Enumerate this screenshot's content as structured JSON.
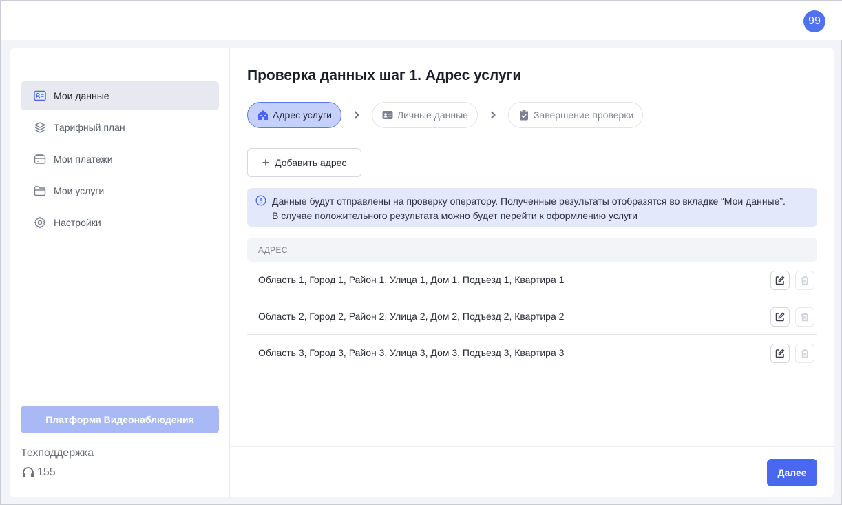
{
  "header": {
    "avatar_text": "99"
  },
  "sidebar": {
    "items": [
      {
        "label": "Мои данные",
        "icon": "id-card-icon",
        "active": true
      },
      {
        "label": "Тарифный план",
        "icon": "layers-icon",
        "active": false
      },
      {
        "label": "Мои платежи",
        "icon": "wallet-icon",
        "active": false
      },
      {
        "label": "Мои услуги",
        "icon": "folder-icon",
        "active": false
      },
      {
        "label": "Настройки",
        "icon": "gear-icon",
        "active": false
      }
    ],
    "video_button": "Платформа Видеонаблюдения",
    "support_title": "Техподдержка",
    "support_phone": "155"
  },
  "main": {
    "title": "Проверка данных шаг 1. Адрес услуги",
    "steps": [
      {
        "label": "Адрес услуги",
        "icon": "house-icon",
        "active": true
      },
      {
        "label": "Личные данные",
        "icon": "id-card-icon",
        "active": false
      },
      {
        "label": "Завершение проверки",
        "icon": "clipboard-check-icon",
        "active": false
      }
    ],
    "add_button": "Добавить адрес",
    "notice_line1": "Данные будут отправлены на проверку оператору. Полученные результаты отобразятся во вкладке “Мои данные”.",
    "notice_line2": "В случае положительного результата можно будет перейти к оформлению услуги",
    "table_header": "АДРЕС",
    "rows": [
      "Область 1, Город 1, Район 1, Улица 1, Дом 1, Подъезд 1, Квартира 1",
      "Область 2, Город 2, Район 2, Улица 2, Дом 2, Подъезд 2, Квартира 2",
      "Область 3, Город 3, Район 3, Улица 3, Дом 3, Подъезд 3, Квартира 3"
    ],
    "next_button": "Далее"
  },
  "colors": {
    "accent": "#4a67f2",
    "accent_light": "#c5d1fb",
    "notice_bg": "#e3e8fb",
    "disabled_button": "#a9b9f6"
  }
}
